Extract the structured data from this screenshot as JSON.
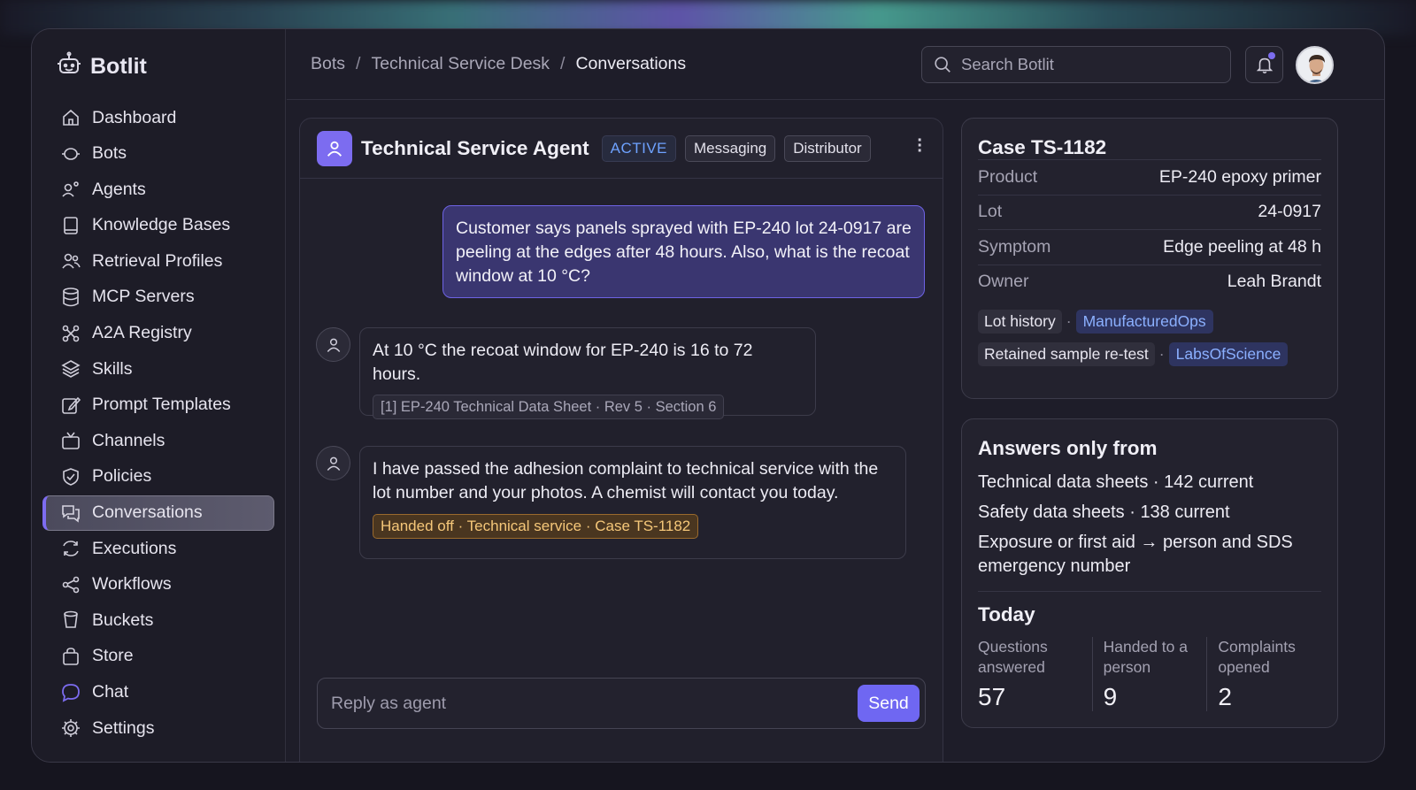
{
  "app": {
    "name": "Botlit"
  },
  "sidebar": {
    "items": [
      {
        "label": "Dashboard",
        "icon": "home-icon"
      },
      {
        "label": "Bots",
        "icon": "bot-icon"
      },
      {
        "label": "Agents",
        "icon": "agents-icon"
      },
      {
        "label": "Knowledge Bases",
        "icon": "book-icon"
      },
      {
        "label": "Retrieval Profiles",
        "icon": "users-icon"
      },
      {
        "label": "MCP Servers",
        "icon": "database-icon"
      },
      {
        "label": "A2A Registry",
        "icon": "network-icon"
      },
      {
        "label": "Skills",
        "icon": "layers-icon"
      },
      {
        "label": "Prompt Templates",
        "icon": "edit-icon"
      },
      {
        "label": "Channels",
        "icon": "tv-icon"
      },
      {
        "label": "Policies",
        "icon": "shield-icon"
      },
      {
        "label": "Conversations",
        "icon": "chat-icon",
        "active": true
      },
      {
        "label": "Executions",
        "icon": "refresh-icon"
      },
      {
        "label": "Workflows",
        "icon": "share-icon"
      },
      {
        "label": "Buckets",
        "icon": "bucket-icon"
      },
      {
        "label": "Store",
        "icon": "bag-icon"
      },
      {
        "label": "Chat",
        "icon": "bubble-icon"
      },
      {
        "label": "Settings",
        "icon": "gear-icon"
      }
    ]
  },
  "header": {
    "breadcrumbs": [
      "Bots",
      "Technical Service Desk",
      "Conversations"
    ],
    "search_placeholder": "Search Botlit"
  },
  "chat": {
    "agent_name": "Technical Service Agent",
    "status": "ACTIVE",
    "tags": [
      "Messaging",
      "Distributor"
    ],
    "user_message": "Customer says panels sprayed with EP-240 lot 24-0917 are peeling at the edges after 48 hours. Also, what is the recoat window at 10 °C?",
    "bot_reply_1": "At 10 °C the recoat window for EP-240 is 16 to 72 hours.",
    "bot_reply_1_citation": "[1] EP-240 Technical Data Sheet · Rev 5 · Section 6",
    "bot_reply_2": "I have passed the adhesion complaint to technical service with the lot number and your photos. A chemist will contact you today.",
    "bot_reply_2_status": "Handed off · Technical service · Case TS-1182",
    "composer_placeholder": "Reply as agent",
    "send_label": "Send"
  },
  "case": {
    "title": "Case TS-1182",
    "fields": [
      {
        "key": "Product",
        "value": "EP-240 epoxy primer"
      },
      {
        "key": "Lot",
        "value": "24-0917"
      },
      {
        "key": "Symptom",
        "value": "Edge peeling at 48 h"
      },
      {
        "key": "Owner",
        "value": "Leah Brandt"
      }
    ],
    "links": [
      {
        "label": "Lot history",
        "source": "ManufacturedOps"
      },
      {
        "label": "Retained sample re-test",
        "source": "LabsOfScience"
      }
    ]
  },
  "answers": {
    "title": "Answers only from",
    "sources": [
      "Technical data sheets · 142 current",
      "Safety data sheets · 138 current",
      "Exposure or first aid → person and SDS emergency number"
    ],
    "today_title": "Today",
    "stats": [
      {
        "label": "Questions answered",
        "value": "57"
      },
      {
        "label": "Handed to a person",
        "value": "9"
      },
      {
        "label": "Complaints opened",
        "value": "2"
      }
    ]
  },
  "colors": {
    "accent": "#7c6cf0",
    "link": "#8bb0ff",
    "handoff": "#f5c779"
  }
}
